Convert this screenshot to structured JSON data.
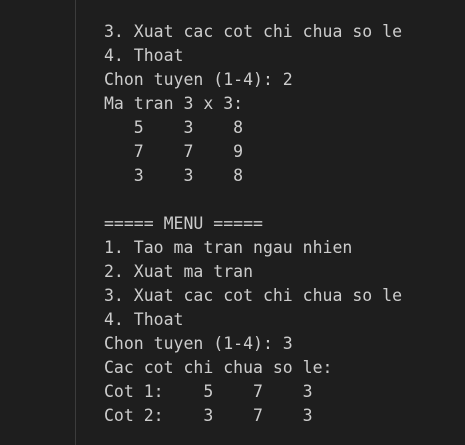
{
  "terminal": {
    "lines": [
      "3. Xuat cac cot chi chua so le",
      "4. Thoat",
      "Chon tuyen (1-4): 2",
      "Ma tran 3 x 3:",
      "   5    3    8",
      "   7    7    9",
      "   3    3    8",
      "",
      "===== MENU =====",
      "1. Tao ma tran ngau nhien",
      "2. Xuat ma tran",
      "3. Xuat cac cot chi chua so le",
      "4. Thoat",
      "Chon tuyen (1-4): 3",
      "Cac cot chi chua so le:",
      "Cot 1:    5    7    3",
      "Cot 2:    3    7    3"
    ]
  },
  "colors": {
    "background": "#1e1e1e",
    "text": "#cccccc",
    "divider": "#3c3c3c"
  }
}
